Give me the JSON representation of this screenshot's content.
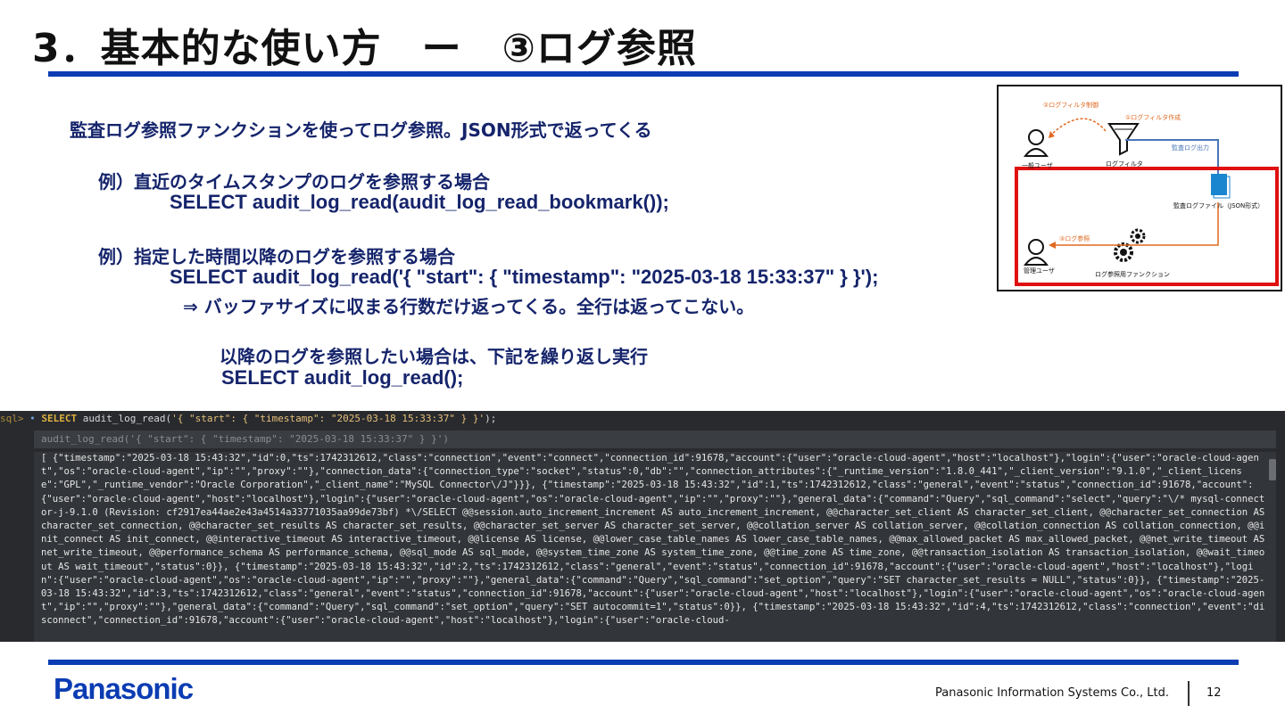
{
  "slide": {
    "title": "3．基本的な使い方　ー　③ログ参照",
    "lead": "監査ログ参照ファンクションを使ってログ参照。JSON形式で返ってくる",
    "example1_label": "例）直近のタイムスタンプのログを参照する場合",
    "example1_sql": "SELECT audit_log_read(audit_log_read_bookmark());",
    "example2_label": "例）指定した時間以降のログを参照する場合",
    "example2_sql": "SELECT audit_log_read('{ \"start\": { \"timestamp\": \"2025-03-18 15:33:37\" } }');",
    "note": "⇒  バッファサイズに収まる行数だけ返ってくる。全行は返ってこない。",
    "repeat_label": "以降のログを参照したい場合は、下記を繰り返し実行",
    "repeat_sql": "SELECT audit_log_read();"
  },
  "diagram": {
    "label_filter_create": "①ログフィルタ作成",
    "label_filter_control": "②ログフィルタ制御",
    "label_log_output": "監査ログ出力",
    "label_log_ref": "③ログ参照",
    "label_general_user": "一般ユーザ",
    "label_log_filter": "ログフィルタ",
    "label_log_file": "監査ログファイル（JSON形式）",
    "label_admin_user": "管理ユーザ",
    "label_ref_function": "ログ参照用ファンクション",
    "highlight_color": "#e01010",
    "arrow_color": "#e06820",
    "flow_color": "#4a76b8"
  },
  "console": {
    "prompt": "sql>",
    "command_keyword": "SELECT",
    "command_rest": " audit_log_read(",
    "command_arg": "'{ \"start\": { \"timestamp\": \"2025-03-18 15:33:37\" } }'",
    "command_end": ");",
    "echo": "audit_log_read('{ \"start\": { \"timestamp\": \"2025-03-18 15:33:37\" } }')",
    "result": "[ {\"timestamp\":\"2025-03-18 15:43:32\",\"id\":0,\"ts\":1742312612,\"class\":\"connection\",\"event\":\"connect\",\"connection_id\":91678,\"account\":{\"user\":\"oracle-cloud-agent\",\"host\":\"localhost\"},\"login\":{\"user\":\"oracle-cloud-agent\",\"os\":\"oracle-cloud-agent\",\"ip\":\"\",\"proxy\":\"\"},\"connection_data\":{\"connection_type\":\"socket\",\"status\":0,\"db\":\"\",\"connection_attributes\":{\"_runtime_version\":\"1.8.0_441\",\"_client_version\":\"9.1.0\",\"_client_license\":\"GPL\",\"_runtime_vendor\":\"Oracle Corporation\",\"_client_name\":\"MySQL Connector\\/J\"}}}, {\"timestamp\":\"2025-03-18 15:43:32\",\"id\":1,\"ts\":1742312612,\"class\":\"general\",\"event\":\"status\",\"connection_id\":91678,\"account\":{\"user\":\"oracle-cloud-agent\",\"host\":\"localhost\"},\"login\":{\"user\":\"oracle-cloud-agent\",\"os\":\"oracle-cloud-agent\",\"ip\":\"\",\"proxy\":\"\"},\"general_data\":{\"command\":\"Query\",\"sql_command\":\"select\",\"query\":\"\\/* mysql-connector-j-9.1.0 (Revision: cf2917ea44ae2e43a4514a33771035aa99de73bf) *\\/SELECT @@session.auto_increment_increment AS auto_increment_increment, @@character_set_client AS character_set_client, @@character_set_connection AS character_set_connection, @@character_set_results AS character_set_results, @@character_set_server AS character_set_server, @@collation_server AS collation_server, @@collation_connection AS collation_connection, @@init_connect AS init_connect, @@interactive_timeout AS interactive_timeout, @@license AS license, @@lower_case_table_names AS lower_case_table_names, @@max_allowed_packet AS max_allowed_packet, @@net_write_timeout AS net_write_timeout, @@performance_schema AS performance_schema, @@sql_mode AS sql_mode, @@system_time_zone AS system_time_zone, @@time_zone AS time_zone, @@transaction_isolation AS transaction_isolation, @@wait_timeout AS wait_timeout\",\"status\":0}}, {\"timestamp\":\"2025-03-18 15:43:32\",\"id\":2,\"ts\":1742312612,\"class\":\"general\",\"event\":\"status\",\"connection_id\":91678,\"account\":{\"user\":\"oracle-cloud-agent\",\"host\":\"localhost\"},\"login\":{\"user\":\"oracle-cloud-agent\",\"os\":\"oracle-cloud-agent\",\"ip\":\"\",\"proxy\":\"\"},\"general_data\":{\"command\":\"Query\",\"sql_command\":\"set_option\",\"query\":\"SET character_set_results = NULL\",\"status\":0}}, {\"timestamp\":\"2025-03-18 15:43:32\",\"id\":3,\"ts\":1742312612,\"class\":\"general\",\"event\":\"status\",\"connection_id\":91678,\"account\":{\"user\":\"oracle-cloud-agent\",\"host\":\"localhost\"},\"login\":{\"user\":\"oracle-cloud-agent\",\"os\":\"oracle-cloud-agent\",\"ip\":\"\",\"proxy\":\"\"},\"general_data\":{\"command\":\"Query\",\"sql_command\":\"set_option\",\"query\":\"SET autocommit=1\",\"status\":0}}, {\"timestamp\":\"2025-03-18 15:43:32\",\"id\":4,\"ts\":1742312612,\"class\":\"connection\",\"event\":\"disconnect\",\"connection_id\":91678,\"account\":{\"user\":\"oracle-cloud-agent\",\"host\":\"localhost\"},\"login\":{\"user\":\"oracle-cloud-"
  },
  "footer": {
    "logo": "Panasonic",
    "company": "Panasonic Information Systems Co., Ltd.",
    "page_number": "12",
    "brand_color": "#0b3cb3"
  }
}
